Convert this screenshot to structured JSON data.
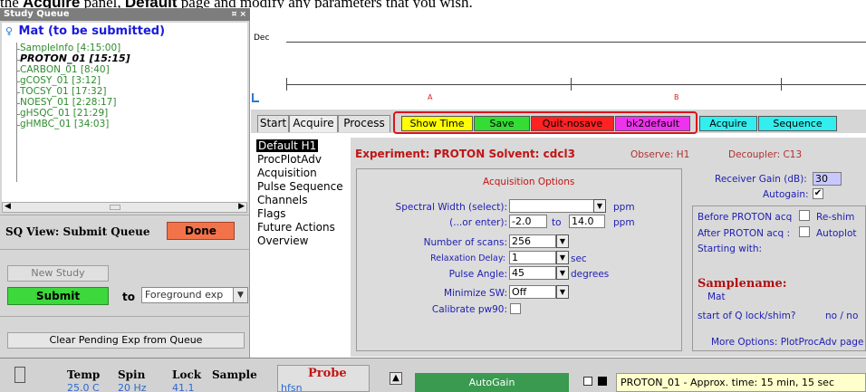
{
  "instruction": {
    "pre": "the ",
    "bold1": "Acquire",
    "mid": " panel, ",
    "bold2": "Default",
    "post": " page and modify any parameters that you wish."
  },
  "study_queue": {
    "title": "Study Queue",
    "header_icons": "¤ ×",
    "root_label": "Mat (to be submitted)",
    "items": [
      {
        "label": "SampleInfo [4:15:00]"
      },
      {
        "label": "PROTON_01 [15:15]"
      },
      {
        "label": "CARBON_01 [8:40]"
      },
      {
        "label": "gCOSY_01 [3:12]"
      },
      {
        "label": "TOCSY_01 [17:32]"
      },
      {
        "label": "NOESY_01 [2:28:17]"
      },
      {
        "label": "gHSQC_01 [21:29]"
      },
      {
        "label": "gHMBC_01 [34:03]"
      }
    ],
    "view_label": "SQ View: Submit Queue",
    "done_label": "Done",
    "new_study_label": "New Study",
    "submit_label": "Submit",
    "to_label": "to",
    "target_value": "Foreground exp",
    "clear_label": "Clear Pending Exp from Queue"
  },
  "spectrum": {
    "label": "Dec",
    "marker_a": "A",
    "marker_b": "B"
  },
  "tabs": {
    "start": "Start",
    "acquire": "Acquire",
    "process": "Process",
    "show_time": "Show Time",
    "save": "Save",
    "quit": "Quit-nosave",
    "bk2default": "bk2default",
    "acquire_btn": "Acquire",
    "sequence": "Sequence"
  },
  "colors": {
    "show_time": "#ffff00",
    "save": "#33dd33",
    "quit": "#ff2222",
    "bk2default": "#ee33ee",
    "acquire_btn": "#33eeee",
    "sequence": "#33eeee",
    "highlight_frame": "#d8141c"
  },
  "nav": {
    "items": [
      "Default H1",
      "ProcPlotAdv",
      "Acquisition",
      "Pulse Sequence",
      "Channels",
      "Flags",
      "Future Actions",
      "Overview"
    ]
  },
  "experiment": {
    "title": "Experiment: PROTON   Solvent: cdcl3",
    "observe": "Observe: H1",
    "decoupler": "Decoupler: C13"
  },
  "acq_options": {
    "title": "Acquisition Options",
    "spectral_width_label": "Spectral Width (select):",
    "spectral_width_value": "",
    "sw_unit": "ppm",
    "enter_label": "(...or enter):",
    "from_value": "-2.0",
    "to_label": "to",
    "to_value": "14.0",
    "enter_unit": "ppm",
    "scans_label": "Number of scans:",
    "scans_value": "256",
    "relax_label": "Relaxation Delay:",
    "relax_value": "1",
    "relax_unit": "sec",
    "pulse_label": "Pulse Angle:",
    "pulse_value": "45",
    "pulse_unit": "degrees",
    "minsw_label": "Minimize SW:",
    "minsw_value": "Off",
    "calib_label": "Calibrate pw90:"
  },
  "right": {
    "receiver_label": "Receiver Gain (dB):",
    "receiver_value": "30",
    "autogain_label": "Autogain:",
    "before_label": "Before PROTON acq",
    "reshim_label": "Re-shim",
    "after_label": "After PROTON acq :",
    "autoplot_label": "Autoplot",
    "starting_label": "Starting with:",
    "samplename_title": "Samplename:",
    "samplename_value": "Mat",
    "lockshim_label": "start of Q lock/shim?",
    "lockshim_value": "no / no",
    "more_options": "More Options: PlotProcAdv page"
  },
  "bottom": {
    "temp_label": "Temp",
    "temp_value": "25.0 C",
    "spin_label": "Spin",
    "spin_value": "20 Hz",
    "lock_label": "Lock",
    "lock_value": "41.1",
    "sample_label": "Sample",
    "probe_label": "Probe",
    "probe_value": "hfsn",
    "autogain_bar": "AutoGain",
    "status_text": "PROTON_01 - Approx. time: 15 min, 15 sec"
  }
}
